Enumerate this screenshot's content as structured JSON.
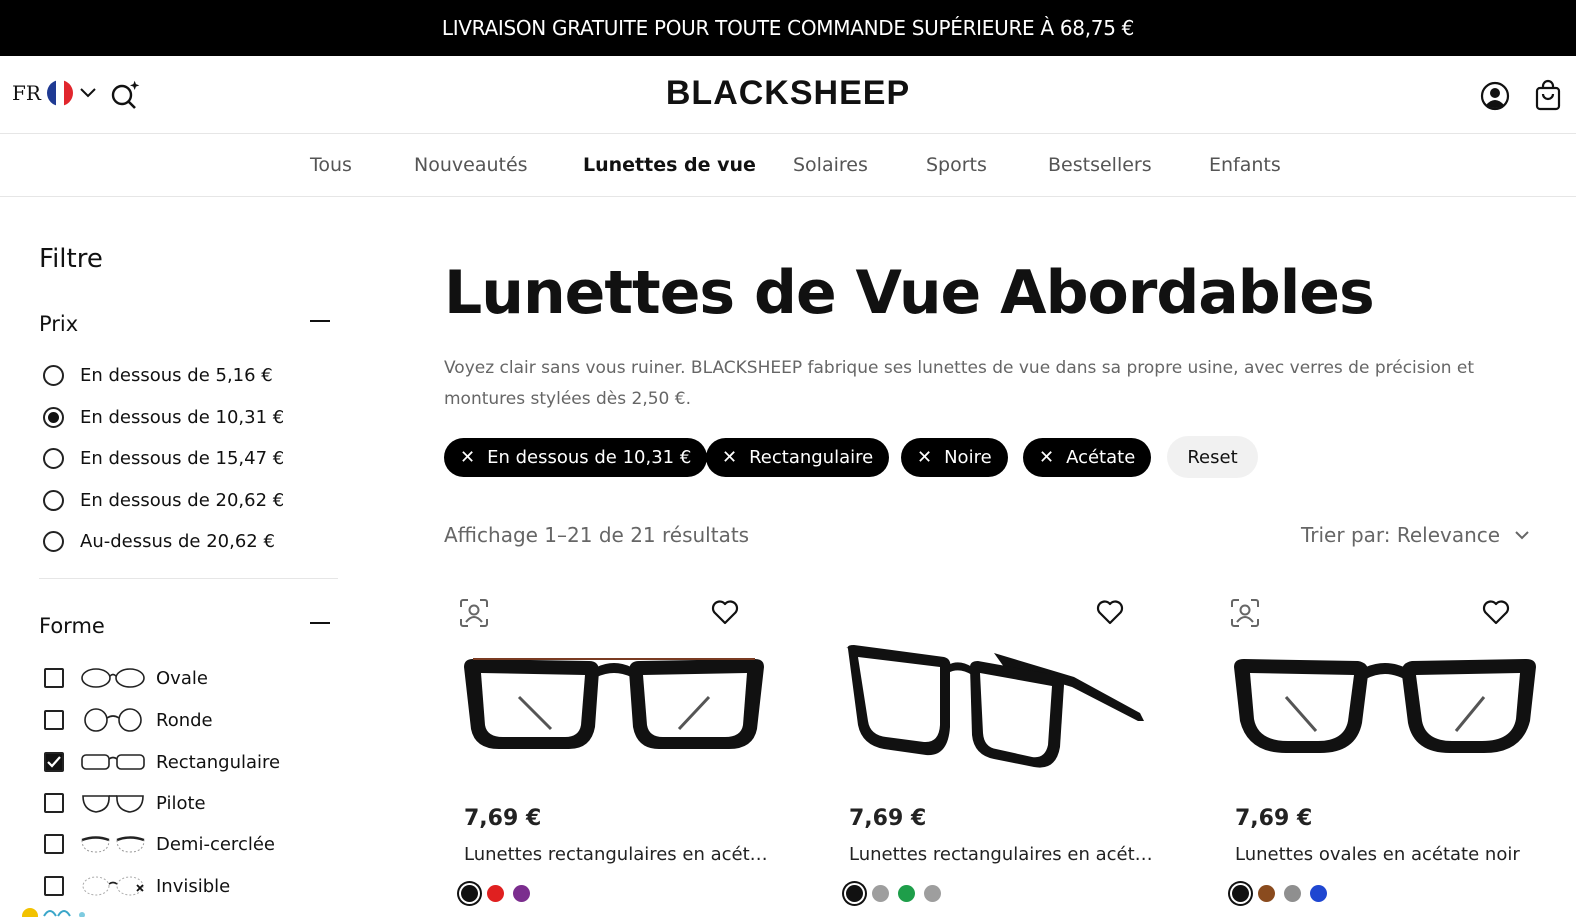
{
  "promo": {
    "text": "LIVRAISON GRATUITE POUR TOUTE COMMANDE SUPÉRIEURE À 68,75 €"
  },
  "header": {
    "lang": "FR",
    "logo": "BLACKSHEEP",
    "flag_colors": [
      "#1f3a93",
      "#ffffff",
      "#e1262d"
    ]
  },
  "nav": {
    "items": [
      {
        "label": "Tous"
      },
      {
        "label": "Nouveautés"
      },
      {
        "label": "Lunettes de vue",
        "active": true
      },
      {
        "label": "Solaires"
      },
      {
        "label": "Sports"
      },
      {
        "label": "Bestsellers"
      },
      {
        "label": "Enfants"
      }
    ]
  },
  "sidebar": {
    "title": "Filtre",
    "price": {
      "label": "Prix",
      "options": [
        {
          "label": "En dessous de 5,16 €",
          "selected": false
        },
        {
          "label": "En dessous de 10,31 €",
          "selected": true
        },
        {
          "label": "En dessous de 15,47 €",
          "selected": false
        },
        {
          "label": "En dessous de 20,62 €",
          "selected": false
        },
        {
          "label": "Au-dessus de 20,62 €",
          "selected": false
        }
      ]
    },
    "shape": {
      "label": "Forme",
      "options": [
        {
          "label": "Ovale",
          "checked": false
        },
        {
          "label": "Ronde",
          "checked": false
        },
        {
          "label": "Rectangulaire",
          "checked": true
        },
        {
          "label": "Pilote",
          "checked": false
        },
        {
          "label": "Demi-cerclée",
          "checked": false
        },
        {
          "label": "Invisible",
          "checked": false
        }
      ]
    }
  },
  "main": {
    "title": "Lunettes de Vue Abordables",
    "intro": "Voyez clair sans vous ruiner. BLACKSHEEP fabrique ses lunettes de vue dans sa propre usine, avec verres de précision et montures stylées dès 2,50 €.",
    "active_filters": [
      {
        "label": "En dessous de 10,31 €"
      },
      {
        "label": "Rectangulaire"
      },
      {
        "label": "Noire"
      },
      {
        "label": "Acétate"
      }
    ],
    "reset_label": "Reset",
    "results_text": "Affichage 1–21 de 21 résultats",
    "sort_label": "Trier par: Relevance"
  },
  "products": [
    {
      "price": "7,69 €",
      "name": "Lunettes rectangulaires en acétat…",
      "try_on": true,
      "swatches": [
        "#111111",
        "#e02020",
        "#7b2d8e"
      ]
    },
    {
      "price": "7,69 €",
      "name": "Lunettes rectangulaires en acétat…",
      "try_on": false,
      "swatches": [
        "#111111",
        "#9e9e9e",
        "#1e9e4a",
        "#9e9e9e"
      ]
    },
    {
      "price": "7,69 €",
      "name": "Lunettes ovales en acétate noir",
      "try_on": true,
      "swatches": [
        "#111111",
        "#8a4b1e",
        "#8f8f8f",
        "#1f47d1"
      ]
    }
  ]
}
